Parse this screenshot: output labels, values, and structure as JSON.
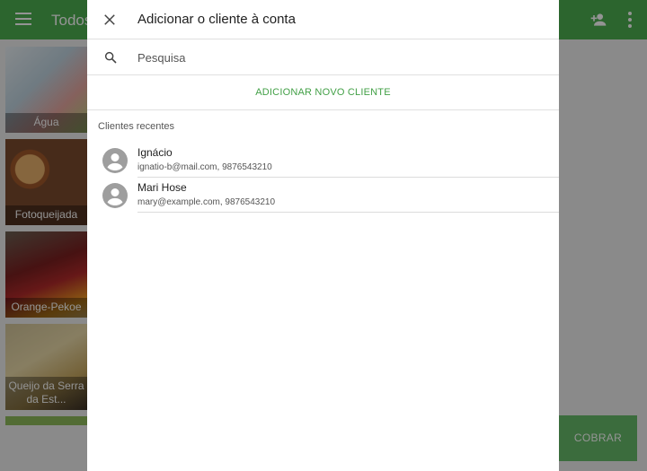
{
  "app": {
    "title": "Todos",
    "cobrar_label": "COBRAR",
    "tiles": [
      {
        "label": "Água"
      },
      {
        "label": "Fotoqueijada"
      },
      {
        "label": "Orange-Pekoe"
      },
      {
        "label": "Queijo da Serra da Est..."
      }
    ]
  },
  "dialog": {
    "title": "Adicionar o cliente à conta",
    "search": {
      "placeholder": "Pesquisa",
      "value": ""
    },
    "add_new_label": "ADICIONAR NOVO CLIENTE",
    "recent_label": "Clientes recentes",
    "clients": [
      {
        "name": "Ignácio",
        "details": "ignatio-b@mail.com, 9876543210"
      },
      {
        "name": "Mari Hose",
        "details": "mary@example.com, 9876543210"
      }
    ]
  },
  "colors": {
    "primary": "#4caf50",
    "accent_text": "#43a047",
    "avatar": "#9e9e9e"
  },
  "icons": [
    "menu-icon",
    "add-person-icon",
    "more-vert-icon",
    "close-icon",
    "search-icon",
    "account-circle-icon"
  ]
}
